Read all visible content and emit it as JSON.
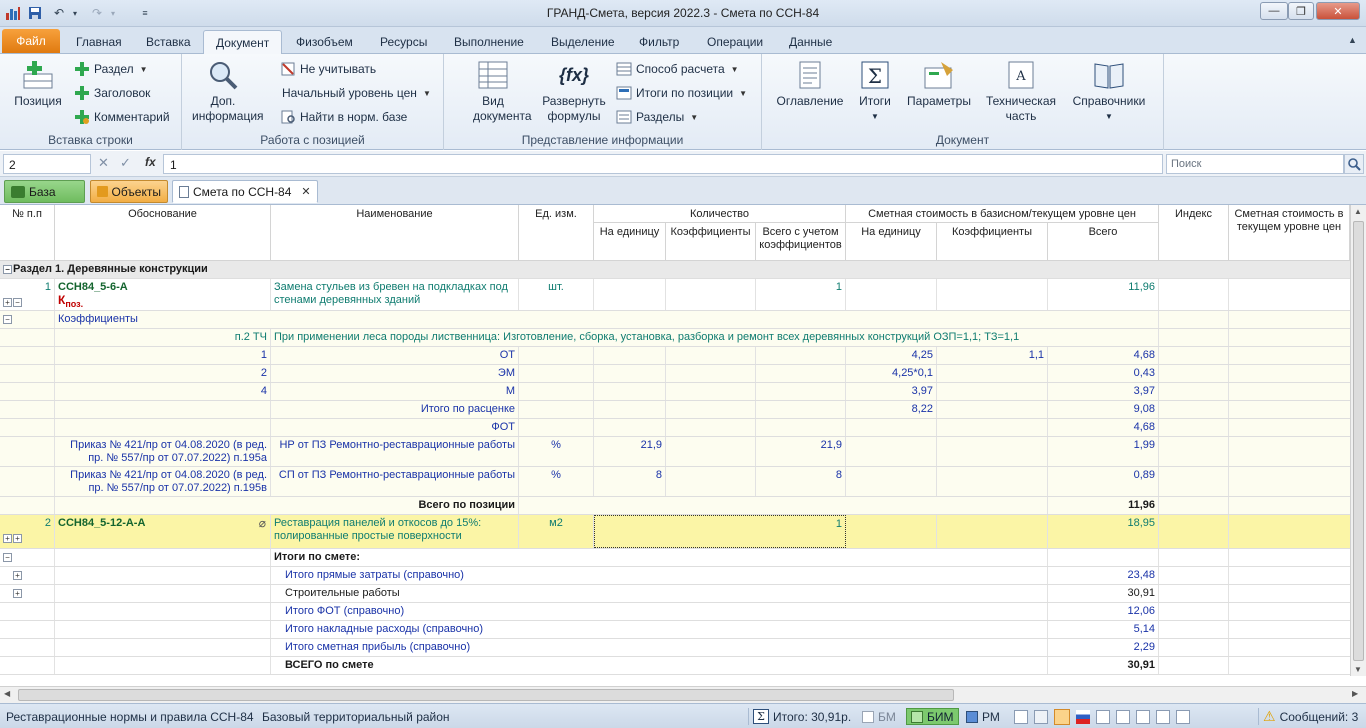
{
  "window": {
    "title": "ГРАНД-Смета, версия 2022.3 - Смета по ССН-84"
  },
  "menu_tabs": [
    "Файл",
    "Главная",
    "Вставка",
    "Документ",
    "Физобъем",
    "Ресурсы",
    "Выполнение",
    "Выделение",
    "Фильтр",
    "Операции",
    "Данные"
  ],
  "ribbon": {
    "insert_group": {
      "label": "Вставка строки",
      "position": "Позиция",
      "section": "Раздел",
      "heading": "Заголовок",
      "comment": "Комментарий"
    },
    "position_group": {
      "label": "Работа с позицией",
      "info": "Доп. информация",
      "ignore": "Не учитывать",
      "price_level": "Начальный уровень цен",
      "find_norm": "Найти в норм. базе"
    },
    "view_group": {
      "label": "Представление информации",
      "doc_view": "Вид документа",
      "expand": "Развернуть формулы",
      "calc_method": "Способ расчета",
      "pos_totals": "Итоги по позиции",
      "sections": "Разделы"
    },
    "document_group": {
      "label": "Документ",
      "toc": "Оглавление",
      "totals": "Итоги",
      "params": "Параметры",
      "tech": "Техническая часть",
      "refs": "Справочники"
    }
  },
  "formula_bar": {
    "cell_ref": "2",
    "value": "1",
    "search_placeholder": "Поиск"
  },
  "doc_tabs": {
    "base": "База",
    "objects": "Объекты",
    "estimate": "Смета по ССН-84"
  },
  "headers": {
    "num": "№ п.п",
    "basis": "Обоснование",
    "name": "Наименование",
    "unit": "Ед. изм.",
    "qty": "Количество",
    "qty_unit": "На единицу",
    "qty_coef": "Коэффициенты",
    "qty_total": "Всего с учетом коэффициентов",
    "cost": "Сметная стоимость в базисном/текущем уровне цен",
    "cost_unit": "На единицу",
    "cost_coef": "Коэффициенты",
    "cost_total": "Всего",
    "index": "Индекс",
    "current": "Сметная стоимость в текущем уровне цен"
  },
  "section_title": "Раздел 1. Деревянные конструкции",
  "pos1": {
    "num": "1",
    "code": "ССН84_5-6-А",
    "k": "К",
    "k_sub": "поз.",
    "name1": "Замена стульев из бревен на подкладках под",
    "name2": "стенами деревянных зданий",
    "unit": "шт.",
    "qty": "1",
    "total": "11,96"
  },
  "coef": {
    "label": "Коэффициенты",
    "basis": "п.2 ТЧ",
    "text": "При применении леса породы лиственница: Изготовление, сборка, установка, разборка и ремонт всех деревянных конструкций  ОЗП=1,1; ТЗ=1,1"
  },
  "res_rows": [
    {
      "n": "1",
      "name": "ОТ",
      "unit_cost": "4,25",
      "coef": "1,1",
      "total": "4,68"
    },
    {
      "n": "2",
      "name": "ЭМ",
      "unit_cost": "4,25*0,1",
      "coef": "",
      "total": "0,43"
    },
    {
      "n": "4",
      "name": "М",
      "unit_cost": "3,97",
      "coef": "",
      "total": "3,97"
    },
    {
      "n": "",
      "name": "Итого по расценке",
      "unit_cost": "8,22",
      "coef": "",
      "total": "9,08"
    },
    {
      "n": "",
      "name": "ФОТ",
      "unit_cost": "",
      "coef": "",
      "total": "4,68"
    }
  ],
  "np": {
    "basis1": "Приказ № 421/пр от 04.08.2020 (в ред.",
    "basis2": "пр. № 557/пр от 07.07.2022) п.195а",
    "name": "НР от ПЗ Ремонтно-реставрационные работы",
    "unit": "%",
    "qty": "21,9",
    "qty_total": "21,9",
    "total": "1,99"
  },
  "sp": {
    "basis1": "Приказ № 421/пр от 04.08.2020 (в ред.",
    "basis2": "пр. № 557/пр от 07.07.2022) п.195в",
    "name": "СП от ПЗ Ремонтно-реставрационные работы",
    "unit": "%",
    "qty": "8",
    "qty_total": "8",
    "total": "0,89"
  },
  "pos_total": {
    "label": "Всего по позиции",
    "value": "11,96"
  },
  "pos2": {
    "num": "2",
    "code": "ССН84_5-12-А-А",
    "name1": "Реставрация панелей и откосов до 15%:",
    "name2": "полированные простые поверхности",
    "unit": "м2",
    "qty": "1",
    "total": "18,95"
  },
  "totals_title": "Итоги по смете:",
  "totals": [
    {
      "label": "Итого прямые затраты (справочно)",
      "value": "23,48",
      "blue": true,
      "plus": true
    },
    {
      "label": "Строительные работы",
      "value": "30,91",
      "blue": false,
      "plus": true
    },
    {
      "label": "Итого ФОТ (справочно)",
      "value": "12,06",
      "blue": true,
      "plus": false
    },
    {
      "label": "Итого накладные расходы (справочно)",
      "value": "5,14",
      "blue": true,
      "plus": false
    },
    {
      "label": "Итого сметная прибыль (справочно)",
      "value": "2,29",
      "blue": true,
      "plus": false
    }
  ],
  "grand_total": {
    "label": "ВСЕГО по смете",
    "value": "30,91"
  },
  "status": {
    "norms": "Реставрационные нормы и правила ССН-84",
    "region": "Базовый территориальный район",
    "total": "Итого: 30,91р.",
    "bm": "БМ",
    "bim": "БИМ",
    "rm": "РМ",
    "messages": "Сообщений: 3"
  }
}
